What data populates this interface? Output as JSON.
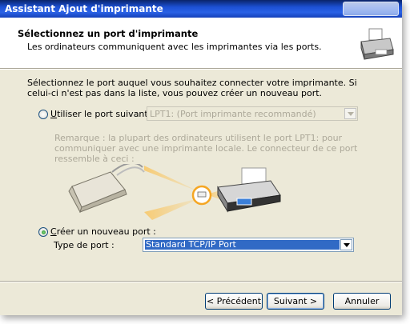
{
  "window": {
    "title": "Assistant Ajout d'imprimante"
  },
  "header": {
    "title": "Sélectionnez un port d'imprimante",
    "subtitle": "Les ordinateurs communiquent avec les imprimantes via les ports."
  },
  "intro": "Sélectionnez le port auquel vous souhaitez connecter votre imprimante. Si celui-ci n'est pas dans la liste, vous pouvez créer un nouveau port.",
  "option_existing": {
    "label_prefix": "U",
    "label_rest": "tiliser le port suivant :",
    "selected": false,
    "value": "LPT1: (Port imprimante recommandé)"
  },
  "note": "Remarque : la plupart des ordinateurs utilisent le port LPT1: pour communiquer avec une imprimante locale. Le connecteur de ce port ressemble à ceci :",
  "option_new": {
    "label_prefix": "C",
    "label_rest": "réer un nouveau port :",
    "selected": true,
    "type_label": "Type de port :",
    "value": "Standard TCP/IP Port"
  },
  "buttons": {
    "back": "< Précédent",
    "next": "Suivant >",
    "cancel": "Annuler"
  },
  "icons": [
    "printer-icon",
    "parallel-connector-illustration",
    "printer-illustration",
    "dropdown-arrow-icon"
  ],
  "colors": {
    "title_bar": "#1c50d4",
    "selection": "#316ac5",
    "radio_selected": "#21a121",
    "highlight_ring": "#f5a623"
  }
}
